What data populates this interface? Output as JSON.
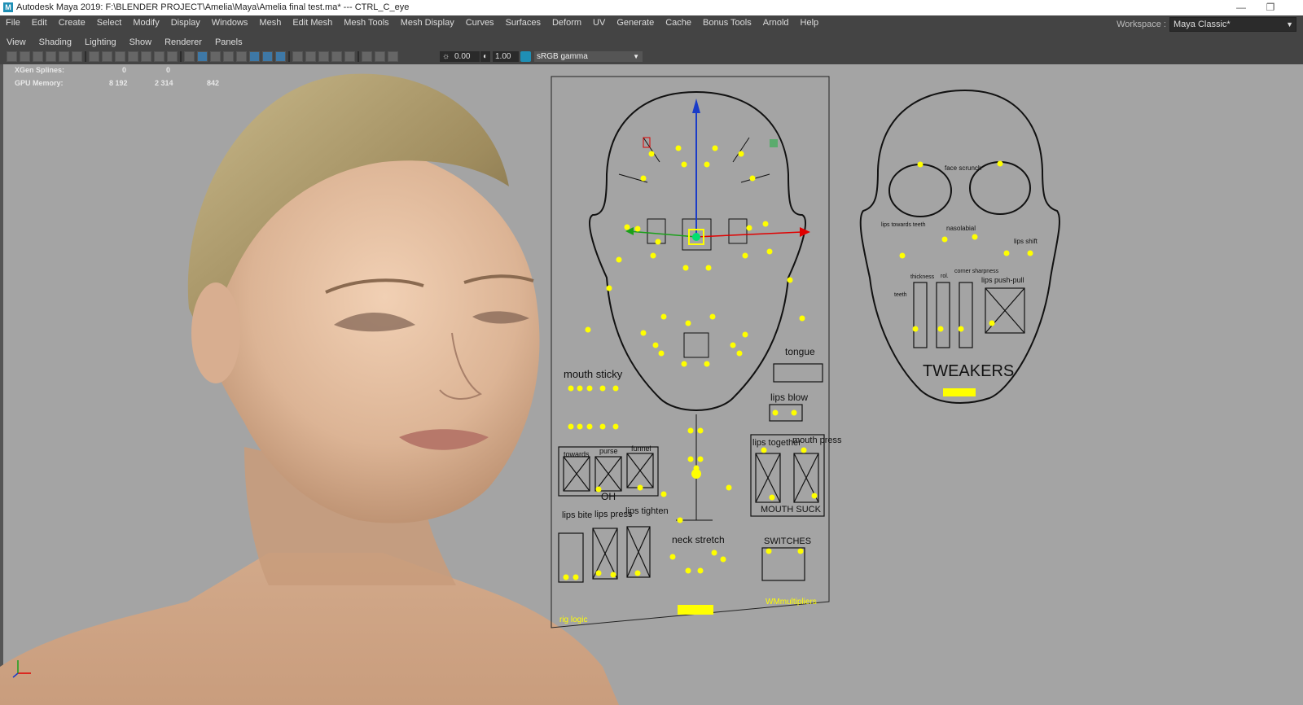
{
  "titlebar": {
    "title": "Autodesk Maya 2019: F:\\BLENDER PROJECT\\Amelia\\Maya\\Amelia final test.ma*  ---  CTRL_C_eye",
    "app_icon": "M",
    "minimize": "—",
    "restore": "❐"
  },
  "menubar": {
    "items": [
      "File",
      "Edit",
      "Create",
      "Select",
      "Modify",
      "Display",
      "Windows",
      "Mesh",
      "Edit Mesh",
      "Mesh Tools",
      "Mesh Display",
      "Curves",
      "Surfaces",
      "Deform",
      "UV",
      "Generate",
      "Cache",
      "Bonus Tools",
      "Arnold",
      "Help"
    ],
    "workspace_label": "Workspace :",
    "workspace_value": "Maya Classic*"
  },
  "panel_menu": {
    "items": [
      "View",
      "Shading",
      "Lighting",
      "Show",
      "Renderer",
      "Panels"
    ]
  },
  "toolbar": {
    "exposure": "0.00",
    "gamma": "1.00",
    "color_space": "sRGB gamma",
    "colors": {
      "accent": "#1f8fb5",
      "active_icon": "#3e78a6"
    }
  },
  "hud": {
    "xgen_label": "XGen Splines:",
    "xgen_v1": "0",
    "xgen_v2": "0",
    "gpu_label": "GPU Memory:",
    "gpu_v1": "8 192",
    "gpu_v2": "2 314",
    "gpu_v3": "842"
  },
  "rig": {
    "mouth_sticky": "mouth sticky",
    "tongue": "tongue",
    "lips_blow": "lips blow",
    "towards": "towards",
    "purse": "purse",
    "funnel": "funnel",
    "oh": "OH",
    "lips_together": "lips together",
    "mouth_press": "mouth press",
    "mouth_suck": "MOUTH SUCK",
    "lips_bite": "lips bite",
    "lips_press": "lips press",
    "lips_tighten": "lips tighten",
    "neck_stretch": "neck stretch",
    "switches": "SWITCHES",
    "wm_multipliers": "WMmultipliers",
    "rig_logic": "rig logic",
    "tweakers": "TWEAKERS",
    "face_scrunch": "face scrunch",
    "nasolabial": "nasolabial",
    "lips_towards_teeth": "lips towards teeth",
    "lips_shift": "lips shift",
    "thickness": "thickness",
    "rol": "rol.",
    "corner_sharpness": "corner sharpness",
    "lips_push_pull": "lips push-pull",
    "teeth": "teeth",
    "colors": {
      "handle": "#ffff00",
      "axis_x": "#e00000",
      "axis_y": "#1a3cc8",
      "axis_z": "#1aa01a"
    }
  }
}
